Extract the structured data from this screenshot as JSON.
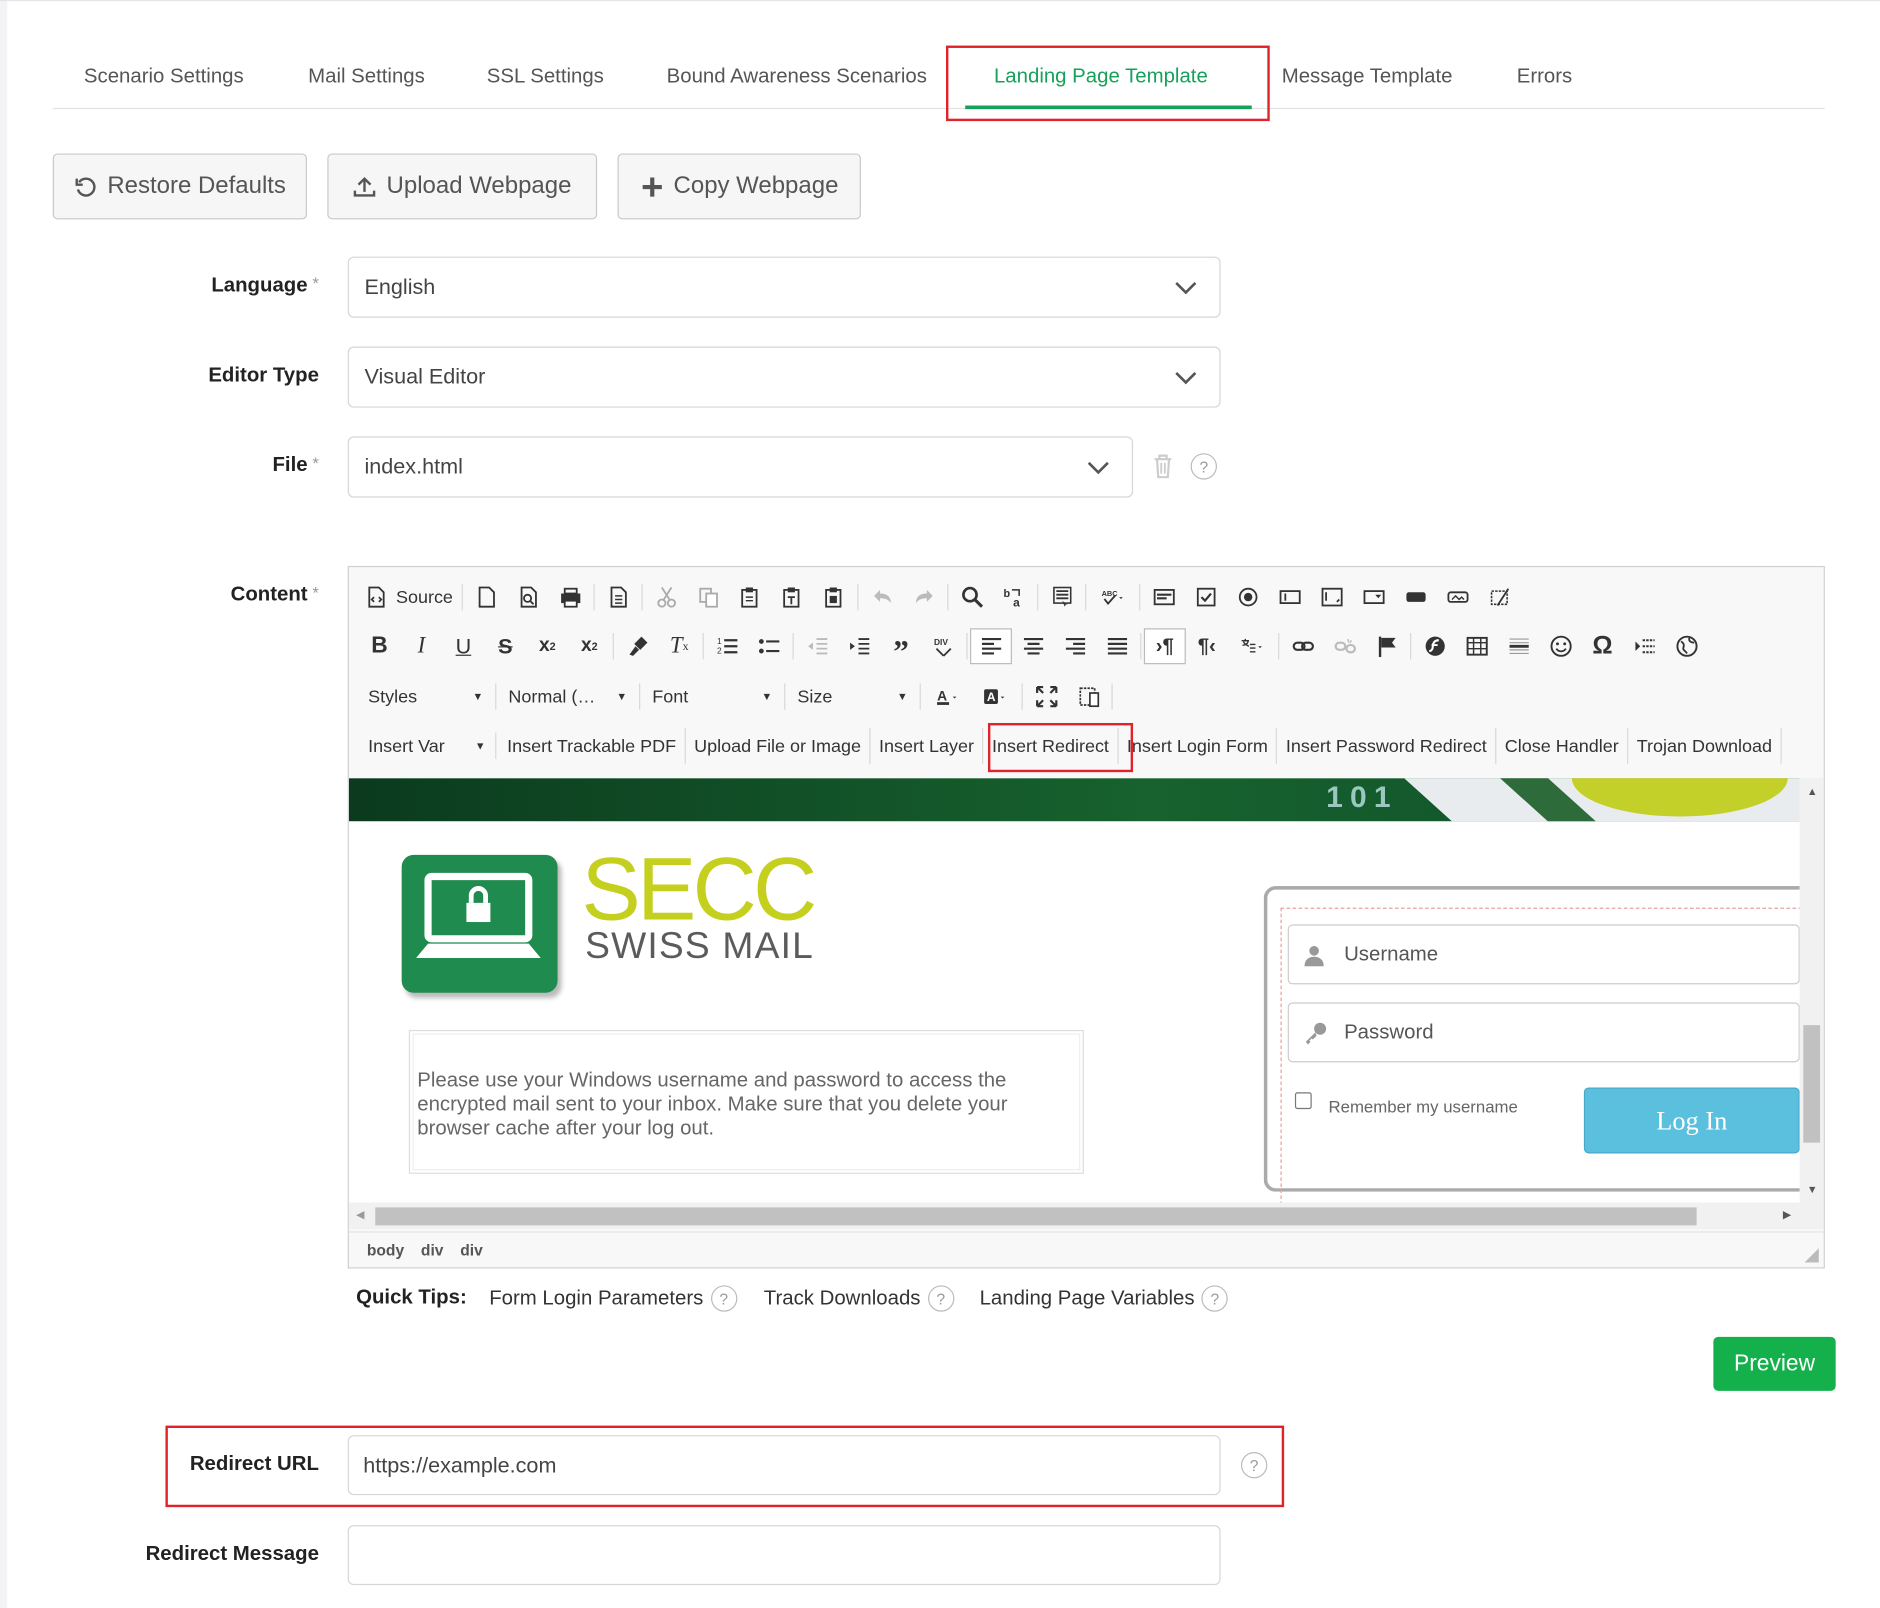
{
  "tabs": {
    "items": [
      "Scenario Settings",
      "Mail Settings",
      "SSL Settings",
      "Bound Awareness Scenarios",
      "Landing Page Template",
      "Message Template",
      "Errors"
    ],
    "active": "Landing Page Template"
  },
  "actions": {
    "restore": "Restore Defaults",
    "upload": "Upload Webpage",
    "copy": "Copy Webpage"
  },
  "form": {
    "language_label": "Language",
    "language_value": "English",
    "editor_type_label": "Editor Type",
    "editor_type_value": "Visual Editor",
    "file_label": "File",
    "file_value": "index.html",
    "content_label": "Content",
    "required_mark": "*"
  },
  "editor": {
    "source_label": "Source",
    "styles_label": "Styles",
    "format_label": "Normal (…",
    "font_label": "Font",
    "size_label": "Size",
    "insert_var_label": "Insert Var",
    "plugins": [
      "Insert Trackable PDF",
      "Upload File or Image",
      "Insert Layer",
      "Insert Redirect",
      "Insert Login Form",
      "Insert Password Redirect",
      "Close Handler",
      "Trojan Download"
    ],
    "path": [
      "body",
      "div",
      "div"
    ]
  },
  "preview_page": {
    "banner_text": "101",
    "brand_name": "SECC",
    "brand_sub": "SWISS MAIL",
    "info_text": "Please use your Windows username and password to access the encrypted mail sent to your inbox. Make sure that you delete your browser cache after your log out.",
    "username_placeholder": "Username",
    "password_placeholder": "Password",
    "remember_label": "Remember my username",
    "login_button": "Log In"
  },
  "quick_tips": {
    "title": "Quick Tips:",
    "items": [
      "Form Login Parameters",
      "Track Downloads",
      "Landing Page Variables"
    ]
  },
  "preview_button": "Preview",
  "redirect": {
    "url_label": "Redirect URL",
    "url_value": "https://example.com",
    "message_label": "Redirect Message",
    "message_value": ""
  },
  "help_mark": "?",
  "colors": {
    "accent_green": "#16a15a",
    "preview_green": "#13b04b",
    "highlight_red": "#e0222a",
    "login_blue": "#5bc0de",
    "brand_lime": "#c4cf1e"
  }
}
